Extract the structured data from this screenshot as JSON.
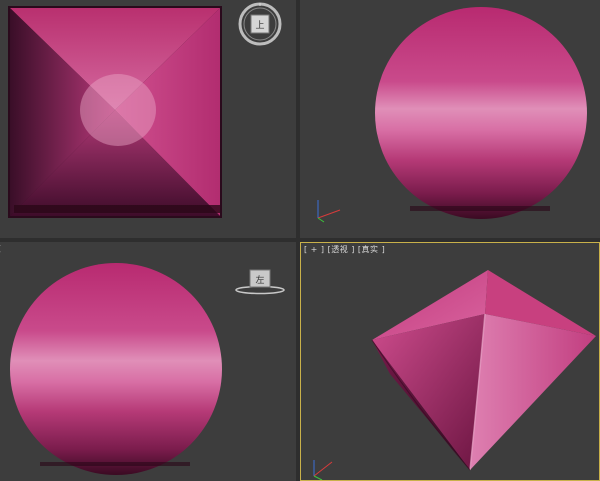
{
  "viewports": {
    "top": {
      "viewcube_label": "上"
    },
    "front": {
      "label": ""
    },
    "left": {
      "label": "[",
      "viewcube_label": "左"
    },
    "perspective": {
      "label": "[ + ] [透视 ] [真实 ]"
    }
  },
  "colors": {
    "background": "#3d3d3d",
    "object_magenta": "#c8377f",
    "object_highlight": "#e596bd",
    "object_dark": "#4a1030",
    "active_border": "#c9b14a"
  },
  "icons": [
    "viewcube-top-icon",
    "viewcube-left-icon",
    "axis-tripod-icon"
  ]
}
